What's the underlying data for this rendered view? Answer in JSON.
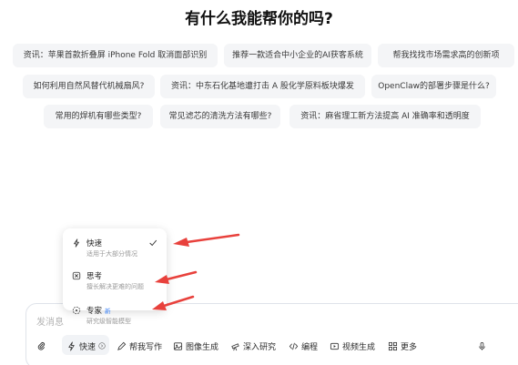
{
  "heading": "有什么我能帮你的吗?",
  "suggestions": [
    "资讯：苹果首款折叠屏 iPhone Fold 取消面部识别",
    "推荐一款适合中小企业的AI获客系统",
    "帮我找找市场需求高的创新项",
    "如何利用自然风替代机械扇风?",
    "资讯：中东石化基地遭打击 A 股化学原料板块爆发",
    "OpenClaw的部署步骤是什么?",
    "常用的焊机有哪些类型?",
    "常见滤芯的清洗方法有哪些?",
    "资讯：麻省理工新方法提高 AI 准确率和透明度"
  ],
  "input": {
    "placeholder": "发消息"
  },
  "toolbar": {
    "mode_label": "快速",
    "write_label": "帮我写作",
    "image_label": "图像生成",
    "research_label": "深入研究",
    "code_label": "编程",
    "video_label": "视频生成",
    "more_label": "更多"
  },
  "mode_menu": {
    "fast": {
      "title": "快速",
      "desc": "适用于大部分情况"
    },
    "think": {
      "title": "思考",
      "desc": "擅长解决更难的问题"
    },
    "expert": {
      "title": "专家",
      "badge": "新",
      "desc": "研究级智能模型"
    }
  },
  "colors": {
    "arrow": "#e8413c",
    "accent": "#3b82f6"
  }
}
